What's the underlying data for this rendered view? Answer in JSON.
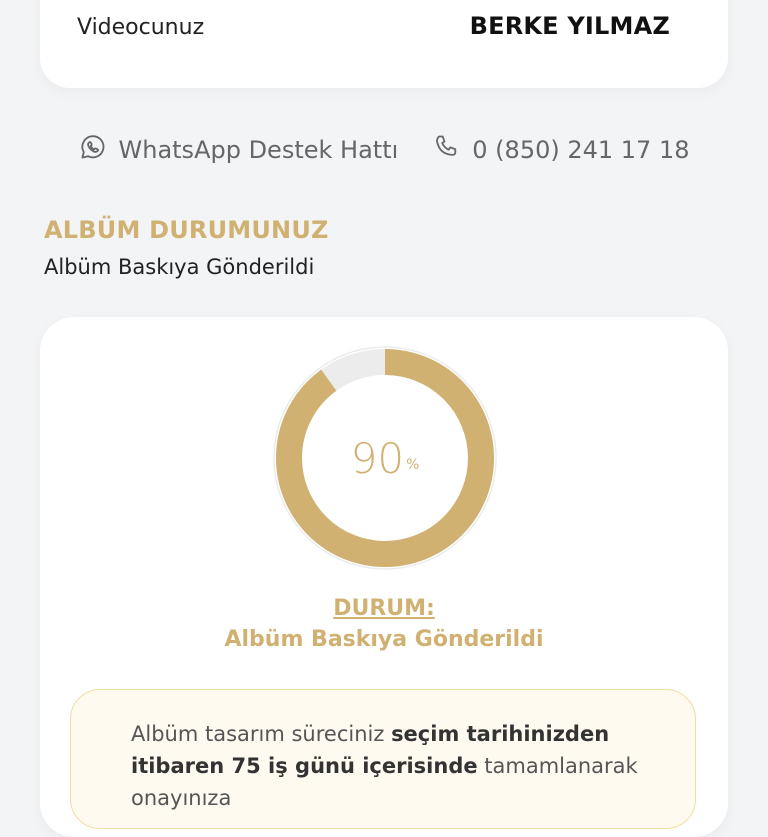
{
  "top_card": {
    "label": "Videocunuz",
    "value": "BERKE YILMAZ"
  },
  "support": {
    "whatsapp_label": "WhatsApp Destek Hattı",
    "phone_label": "0 (850) 241 17 18",
    "whatsapp_icon": "whatsapp-icon",
    "phone_icon": "phone-icon"
  },
  "album_status": {
    "heading": "ALBÜM DURUMUNUZ",
    "subtitle": "Albüm Baskıya Gönderildi"
  },
  "progress": {
    "value": 90,
    "display": "90",
    "unit": "%",
    "status_label": "DURUM:",
    "status_value": "Albüm Baskıya Gönderildi"
  },
  "info": {
    "part1": "Albüm tasarım süreciniz ",
    "bold1": "seçim tarihinizden itibaren 75 iş günü içerisinde",
    "part2": " tamamlanarak onayınıza"
  },
  "colors": {
    "accent": "#d1b172",
    "track": "#ececec",
    "background": "#f3f4f6"
  }
}
